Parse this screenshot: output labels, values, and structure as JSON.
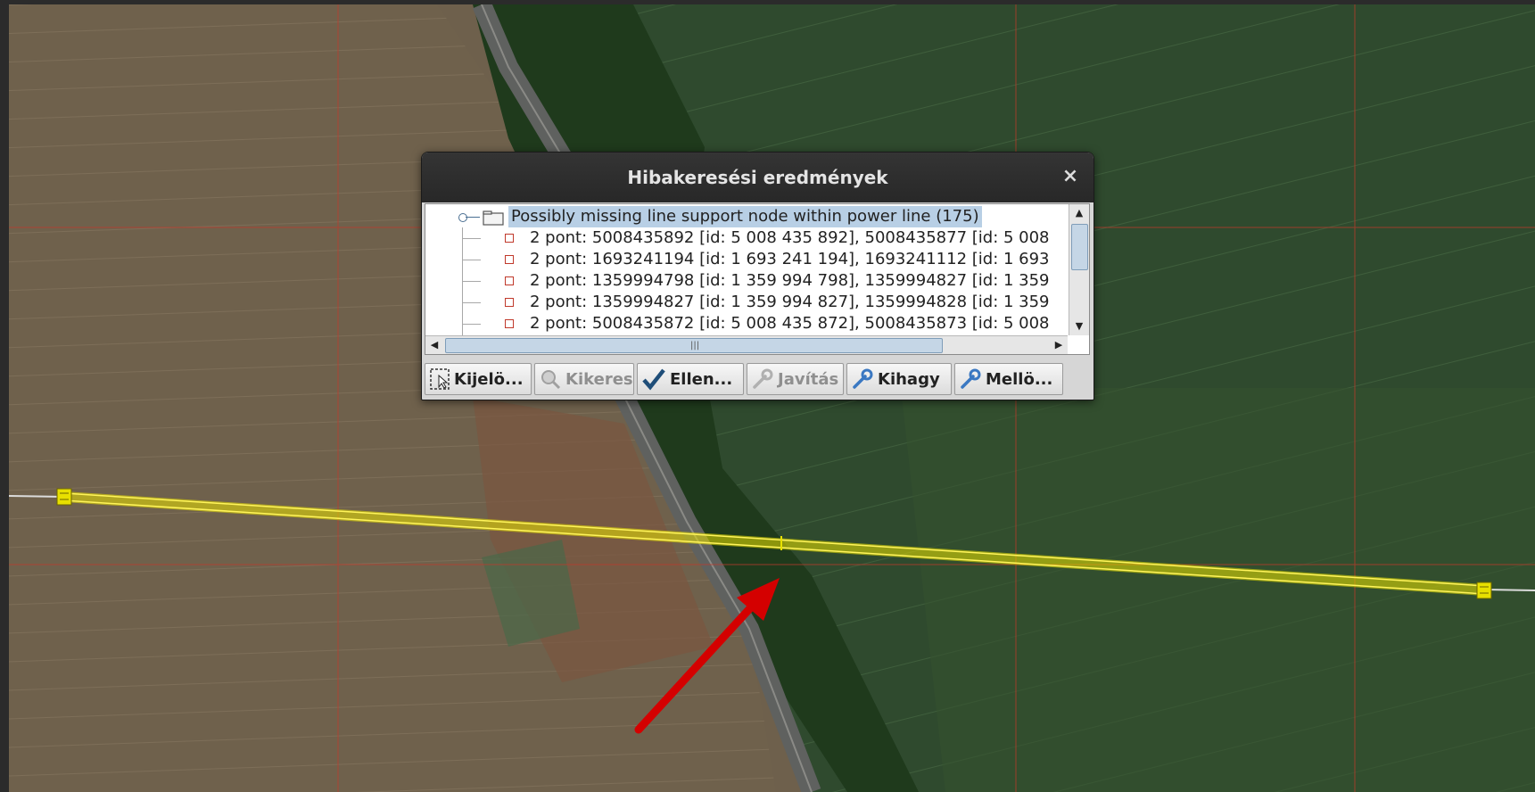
{
  "dialog": {
    "title": "Hibakeresési eredmények",
    "close_label": "×",
    "tree": {
      "root": "Possibly missing line support node within power line (175)",
      "items": [
        "2 pont: 5008435892 [id: 5 008 435 892], 5008435877 [id: 5 008",
        "2 pont: 1693241194 [id: 1 693 241 194], 1693241112 [id: 1 693",
        "2 pont: 1359994798 [id: 1 359 994 798], 1359994827 [id: 1 359",
        "2 pont: 1359994827 [id: 1 359 994 827], 1359994828 [id: 1 359",
        "2 pont: 5008435872 [id: 5 008 435 872], 5008435873 [id: 5 008"
      ]
    },
    "buttons": [
      {
        "label": "Kijelö...",
        "icon": "select-icon",
        "enabled": true
      },
      {
        "label": "Kikeres",
        "icon": "zoom-icon",
        "enabled": false
      },
      {
        "label": "Ellen...",
        "icon": "checkmark-icon",
        "enabled": true
      },
      {
        "label": "Javítás",
        "icon": "wrench-icon",
        "enabled": false
      },
      {
        "label": "Kihagy",
        "icon": "wrench-icon",
        "enabled": true
      },
      {
        "label": "Mellö...",
        "icon": "wrench-icon",
        "enabled": true
      }
    ]
  },
  "colors": {
    "power_line": "#e8e000",
    "grid_line": "#c0392b",
    "annotation_arrow": "#d40000",
    "selection": "#b8cfe5"
  }
}
